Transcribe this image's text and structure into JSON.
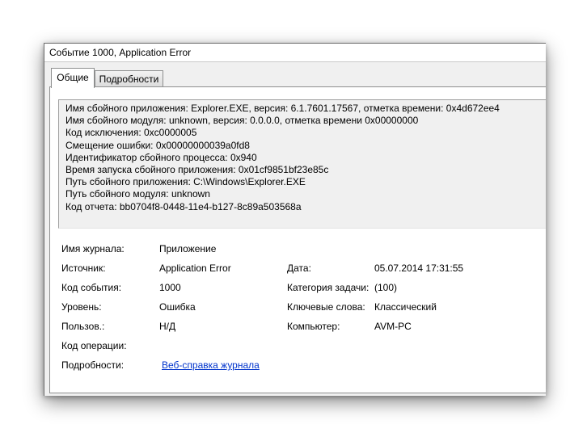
{
  "window": {
    "title": "Событие 1000, Application Error"
  },
  "tabs": [
    {
      "label": "Общие"
    },
    {
      "label": "Подробности"
    }
  ],
  "description": {
    "lines": [
      "Имя сбойного приложения: Explorer.EXE, версия: 6.1.7601.17567, отметка времени: 0x4d672ee4",
      "Имя сбойного модуля: unknown, версия: 0.0.0.0, отметка времени 0x00000000",
      "Код исключения: 0xc0000005",
      "Смещение ошибки: 0x00000000039a0fd8",
      "Идентификатор сбойного процесса: 0x940",
      "Время запуска сбойного приложения: 0x01cf9851bf23e85c",
      "Путь сбойного приложения: C:\\Windows\\Explorer.EXE",
      "Путь сбойного модуля: unknown",
      "Код отчета: bb0704f8-0448-11e4-b127-8c89a503568a"
    ]
  },
  "properties": {
    "log_name": {
      "label": "Имя журнала:",
      "value": "Приложение"
    },
    "source": {
      "label": "Источник:",
      "value": "Application Error"
    },
    "date": {
      "label": "Дата:",
      "value": "05.07.2014 17:31:55"
    },
    "event_id": {
      "label": "Код события:",
      "value": "1000"
    },
    "task_category": {
      "label": "Категория задачи:",
      "value": "(100)"
    },
    "level": {
      "label": "Уровень:",
      "value": "Ошибка"
    },
    "keywords": {
      "label": "Ключевые слова:",
      "value": "Классический"
    },
    "user": {
      "label": "Пользов.:",
      "value": "Н/Д"
    },
    "computer": {
      "label": "Компьютер:",
      "value": "AVM-PC"
    },
    "opcode": {
      "label": "Код операции:",
      "value": ""
    },
    "more_info": {
      "label": "Подробности:",
      "link": "Веб-справка журнала "
    }
  }
}
